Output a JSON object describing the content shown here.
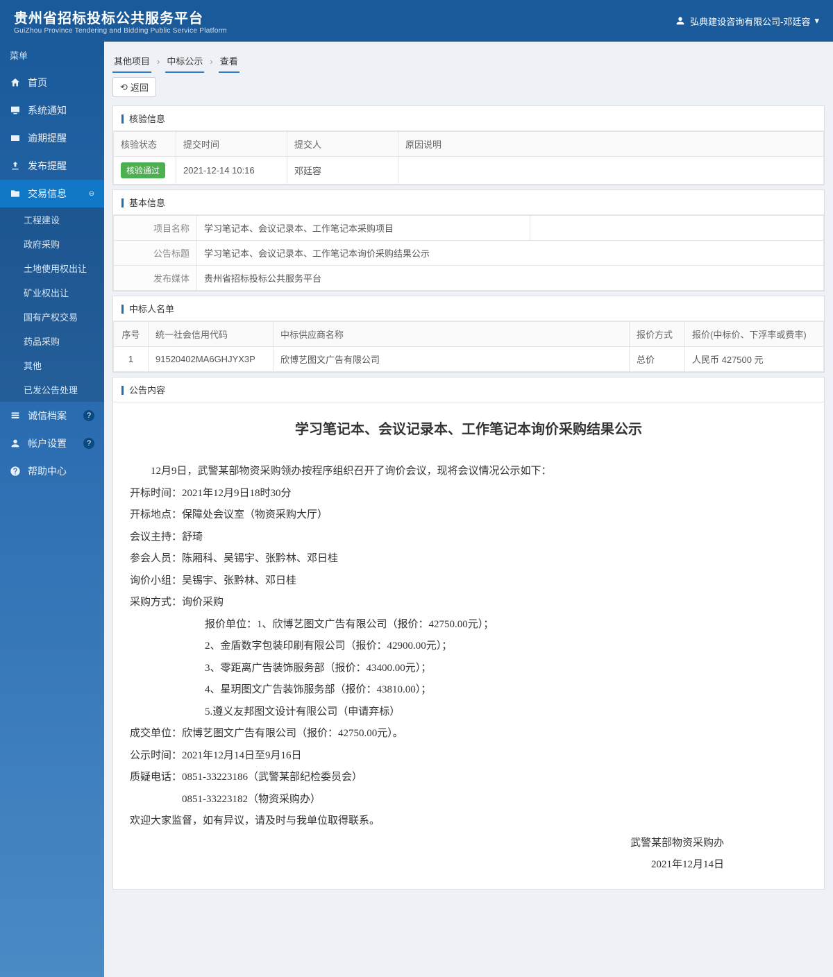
{
  "header": {
    "title": "贵州省招标投标公共服务平台",
    "subtitle": "GuiZhou Province Tendering and Bidding Public Service Platform",
    "user": "弘典建设咨询有限公司-邓廷容"
  },
  "sidebar": {
    "menu_label": "菜单",
    "items": [
      {
        "label": "首页",
        "icon": "home"
      },
      {
        "label": "系统通知",
        "icon": "notice"
      },
      {
        "label": "逾期提醒",
        "icon": "overdue"
      },
      {
        "label": "发布提醒",
        "icon": "publish"
      },
      {
        "label": "交易信息",
        "icon": "trade",
        "active": true,
        "expanded": true
      },
      {
        "label": "诚信档案",
        "icon": "credit",
        "badge": "?"
      },
      {
        "label": "帐户设置",
        "icon": "account",
        "badge": "?"
      },
      {
        "label": "帮助中心",
        "icon": "help"
      }
    ],
    "submenu": [
      {
        "label": "工程建设"
      },
      {
        "label": "政府采购"
      },
      {
        "label": "土地使用权出让"
      },
      {
        "label": "矿业权出让"
      },
      {
        "label": "国有产权交易"
      },
      {
        "label": "药品采购"
      },
      {
        "label": "其他"
      },
      {
        "label": "已发公告处理"
      }
    ]
  },
  "breadcrumb": [
    "其他项目",
    "中标公示",
    "查看"
  ],
  "back_label": "返回",
  "panels": {
    "verify": {
      "title": "核验信息",
      "headers": [
        "核验状态",
        "提交时间",
        "提交人",
        "原因说明"
      ],
      "row": {
        "status": "核验通过",
        "time": "2021-12-14 10:16",
        "submitter": "邓廷容",
        "reason": ""
      }
    },
    "basic": {
      "title": "基本信息",
      "rows": [
        {
          "label": "项目名称",
          "value": "学习笔记本、会议记录本、工作笔记本采购项目"
        },
        {
          "label": "公告标题",
          "value": "学习笔记本、会议记录本、工作笔记本询价采购结果公示"
        },
        {
          "label": "发布媒体",
          "value": "贵州省招标投标公共服务平台"
        }
      ]
    },
    "bidders": {
      "title": "中标人名单",
      "headers": [
        "序号",
        "统一社会信用代码",
        "中标供应商名称",
        "报价方式",
        "报价(中标价、下浮率或费率)"
      ],
      "rows": [
        {
          "no": "1",
          "code": "91520402MA6GHJYX3P",
          "name": "欣博艺图文广告有限公司",
          "method": "总价",
          "price": "人民币 427500 元"
        }
      ]
    },
    "announce": {
      "title": "公告内容",
      "doc_title": "学习笔记本、会议记录本、工作笔记本询价采购结果公示",
      "intro": "12月9日，武警某部物资采购领办按程序组织召开了询价会议，现将会议情况公示如下：",
      "open_time": "开标时间：2021年12月9日18时30分",
      "open_place": "开标地点：保障处会议室（物资采购大厅）",
      "host": "会议主持：舒琦",
      "attendees": "参会人员：陈厢科、吴锡宇、张黔林、邓日桂",
      "group": "询价小组：吴锡宇、张黔林、邓日桂",
      "method": "采购方式：询价采购",
      "quote_label": "报价单位：",
      "quotes": [
        "1、欣博艺图文广告有限公司（报价：42750.00元）；",
        "2、金盾数字包装印刷有限公司（报价：42900.00元）；",
        "3、零距离广告装饰服务部（报价：43400.00元）；",
        "4、星玥图文广告装饰服务部（报价：43810.00）；",
        "5.遵义友邦图文设计有限公司（申请弃标）"
      ],
      "winner": "成交单位：欣博艺图文广告有限公司（报价：42750.00元）。",
      "pub_time": "公示时间：2021年12月14日至9月16日",
      "phone1": "质疑电话：0851-33223186（武警某部纪检委员会）",
      "phone2": "0851-33223182（物资采购办）",
      "footer": "欢迎大家监督，如有异议，请及时与我单位取得联系。",
      "sig_unit": "武警某部物资采购办",
      "sig_date": "2021年12月14日"
    }
  }
}
